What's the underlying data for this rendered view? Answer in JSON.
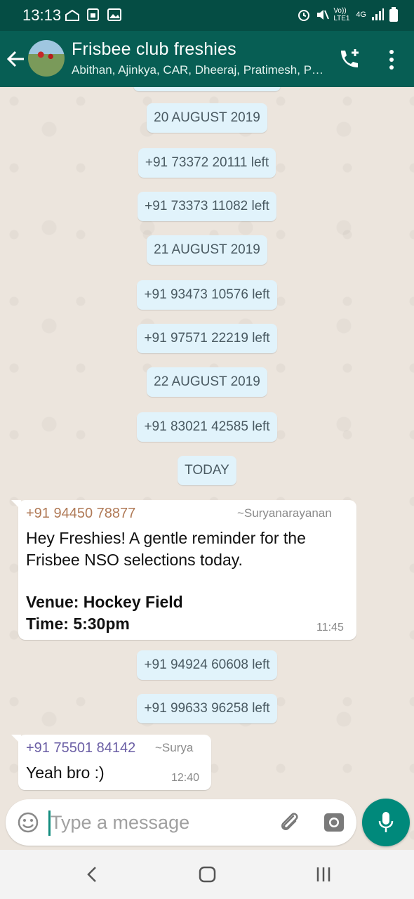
{
  "status_bar": {
    "time": "13:13",
    "network_label": "Vo)) LTE1",
    "network_type": "4G"
  },
  "header": {
    "title": "Frisbee club freshies",
    "subtitle": "Abithan, Ajinkya, CAR, Dheeraj, Pratimesh, Prithvi, Surya, You"
  },
  "chat": {
    "events": [
      {
        "text": "20 AUGUST 2019"
      },
      {
        "text": "+91 73372 20111 left"
      },
      {
        "text": "+91 73373 11082 left"
      },
      {
        "text": "21 AUGUST 2019"
      },
      {
        "text": "+91 93473 10576 left"
      },
      {
        "text": "+91 97571 22219 left"
      },
      {
        "text": "22 AUGUST 2019"
      },
      {
        "text": "+91 83021 42585 left"
      },
      {
        "text": "TODAY"
      },
      {
        "text": "+91 94924 60608 left"
      },
      {
        "text": "+91 99633 96258 left"
      }
    ],
    "messages": [
      {
        "sender": "+91 94450 78877",
        "sender_color": "#b07a57",
        "alias": "~Suryanarayanan",
        "line1": "Hey Freshies! A gentle reminder for the",
        "line2": "Frisbee NSO selections today.",
        "line3": "Venue: Hockey Field",
        "line4": "Time: 5:30pm",
        "time": "11:45"
      },
      {
        "sender": "+91 75501 84142",
        "sender_color": "#6b5fa5",
        "alias": "~Surya",
        "text": "Yeah bro  :)",
        "time": "12:40"
      }
    ]
  },
  "composer": {
    "placeholder": "Type a message",
    "value": ""
  },
  "colors": {
    "header": "#075e54",
    "status_bar": "#054d44",
    "accent": "#00897b",
    "system_chip": "#e1f3fb"
  }
}
